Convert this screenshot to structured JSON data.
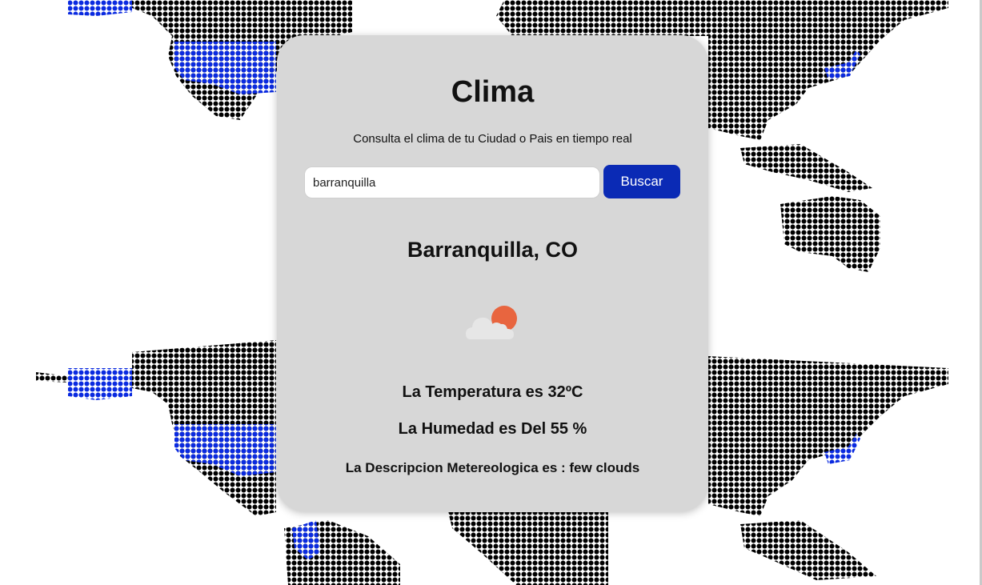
{
  "app": {
    "title": "Clima",
    "subtitle": "Consulta el clima de tu Ciudad o Pais en tiempo real"
  },
  "search": {
    "value": "barranquilla",
    "placeholder": "",
    "button_label": "Buscar"
  },
  "result": {
    "city": "Barranquilla, CO",
    "icon": "few-clouds-icon",
    "temperature_text": "La Temperatura es 32ºC",
    "humidity_text": "La Humedad es Del 55 %",
    "description_text": "La Descripcion Metereologica es : few clouds"
  },
  "colors": {
    "card_bg": "#d7d7d7",
    "button_bg": "#0a2ab5",
    "map_dots": "#000000",
    "map_highlight": "#0a2ae0",
    "sun": "#e8653f",
    "cloud": "#e6e6e6"
  }
}
